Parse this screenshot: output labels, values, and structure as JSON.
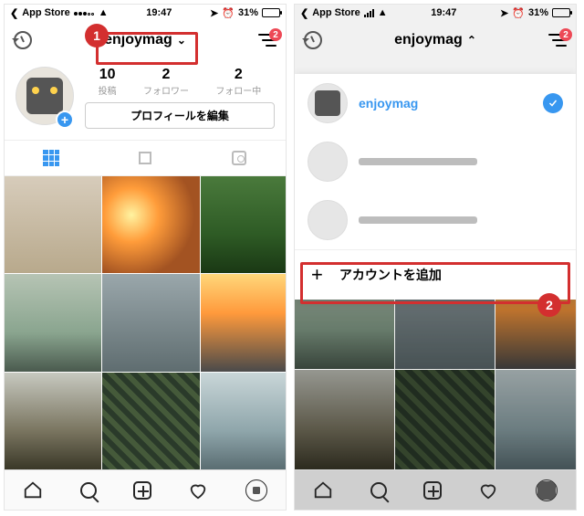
{
  "status": {
    "back_app": "App Store",
    "time": "19:47",
    "battery_pct": "31%"
  },
  "profile": {
    "username": "enjoymag",
    "notif_count": "2",
    "stats": [
      {
        "num": "10",
        "label": "投稿"
      },
      {
        "num": "2",
        "label": "フォロワー"
      },
      {
        "num": "2",
        "label": "フォロー中"
      }
    ],
    "edit_label": "プロフィールを編集"
  },
  "sheet": {
    "selected_username": "enjoymag",
    "add_account_label": "アカウントを追加"
  },
  "callouts": {
    "one": "1",
    "two": "2"
  }
}
